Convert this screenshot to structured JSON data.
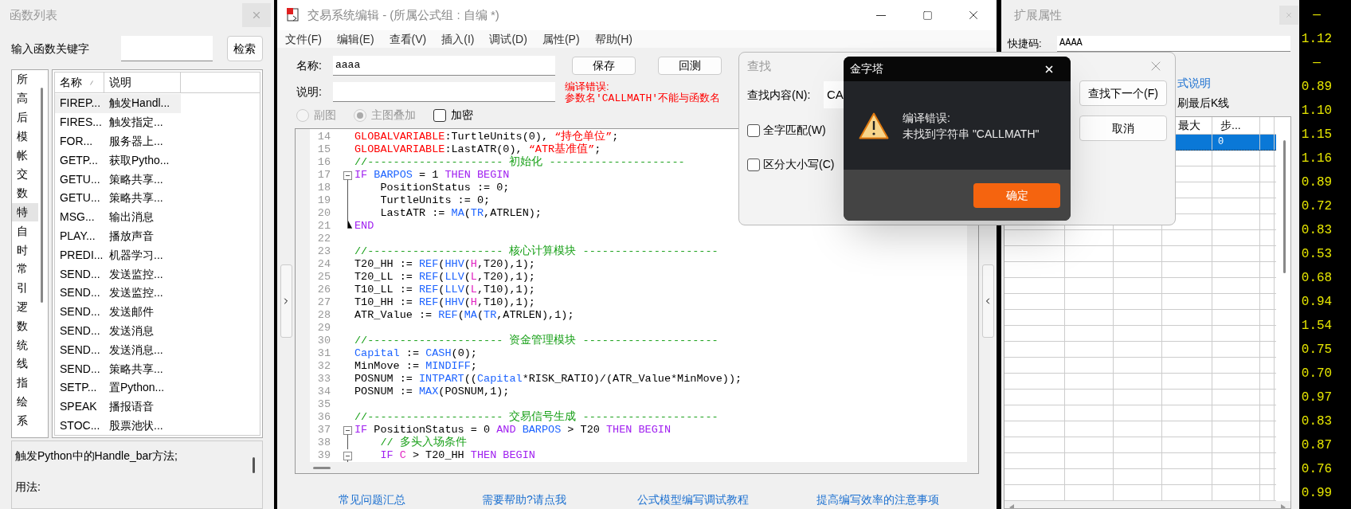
{
  "function_list": {
    "title": "函数列表",
    "search_label": "输入函数关键字",
    "search_button": "检索",
    "categories": [
      {
        "label": "所",
        "selected": false
      },
      {
        "label": "高",
        "selected": false
      },
      {
        "label": "后",
        "selected": false
      },
      {
        "label": "模",
        "selected": false
      },
      {
        "label": "帐",
        "selected": false
      },
      {
        "label": "交",
        "selected": false
      },
      {
        "label": "数",
        "selected": false
      },
      {
        "label": "特",
        "selected": true
      },
      {
        "label": "自",
        "selected": false
      },
      {
        "label": "时",
        "selected": false
      },
      {
        "label": "常",
        "selected": false
      },
      {
        "label": "引",
        "selected": false
      },
      {
        "label": "逻",
        "selected": false
      },
      {
        "label": "数",
        "selected": false
      },
      {
        "label": "统",
        "selected": false
      },
      {
        "label": "线",
        "selected": false
      },
      {
        "label": "指",
        "selected": false
      },
      {
        "label": "绘",
        "selected": false
      },
      {
        "label": "系",
        "selected": false
      }
    ],
    "columns": [
      "名称",
      "说明"
    ],
    "rows": [
      {
        "name": "FIREP...",
        "desc": "触发Handl...",
        "selected": true
      },
      {
        "name": "FIRES...",
        "desc": "触发指定...",
        "selected": false
      },
      {
        "name": "FOR...",
        "desc": "服务器上...",
        "selected": false
      },
      {
        "name": "GETP...",
        "desc": "获取Pytho...",
        "selected": false
      },
      {
        "name": "GETU...",
        "desc": "策略共享...",
        "selected": false
      },
      {
        "name": "GETU...",
        "desc": "策略共享...",
        "selected": false
      },
      {
        "name": "MSG...",
        "desc": "输出消息",
        "selected": false
      },
      {
        "name": "PLAY...",
        "desc": "播放声音",
        "selected": false
      },
      {
        "name": "PREDI...",
        "desc": "机器学习...",
        "selected": false
      },
      {
        "name": "SEND...",
        "desc": "发送监控...",
        "selected": false
      },
      {
        "name": "SEND...",
        "desc": "发送监控...",
        "selected": false
      },
      {
        "name": "SEND...",
        "desc": "发送邮件",
        "selected": false
      },
      {
        "name": "SEND...",
        "desc": "发送消息",
        "selected": false
      },
      {
        "name": "SEND...",
        "desc": "发送消息...",
        "selected": false
      },
      {
        "name": "SEND...",
        "desc": "策略共享...",
        "selected": false
      },
      {
        "name": "SETP...",
        "desc": "置Python...",
        "selected": false
      },
      {
        "name": "SPEAK",
        "desc": "播报语音",
        "selected": false
      },
      {
        "name": "STOC...",
        "desc": "股票池状...",
        "selected": false
      }
    ],
    "description": [
      "触发Python中的Handle_bar方法;",
      "用法:"
    ]
  },
  "editor": {
    "title": "交易系统编辑 - (所属公式组 : 自编 *)",
    "menu": [
      "文件(F)",
      "编辑(E)",
      "查看(V)",
      "插入(I)",
      "调试(D)",
      "属性(P)",
      "帮助(H)"
    ],
    "name_label": "名称:",
    "name_value": "aaaa",
    "desc_label": "说明:",
    "save_button": "保存",
    "backtest_button": "回测",
    "error_lines": [
      "编译错误:",
      "参数名'CALLMATH'不能与函数名"
    ],
    "options": [
      {
        "kind": "radio",
        "label": "副图",
        "selected": false,
        "disabled": true
      },
      {
        "kind": "radio",
        "label": "主图叠加",
        "selected": true,
        "disabled": true
      },
      {
        "kind": "checkbox",
        "label": "加密",
        "checked": false,
        "disabled": false
      }
    ],
    "code_lines": [
      {
        "number": "14",
        "tokens": [
          {
            "kind": "decl",
            "text": "GLOBALVARIABLE"
          },
          {
            "kind": "plain",
            "text": ":TurtleUnits(0), "
          },
          {
            "kind": "str",
            "text": "“持仓单位”"
          },
          {
            "kind": "plain",
            "text": ";"
          }
        ]
      },
      {
        "number": "15",
        "tokens": [
          {
            "kind": "decl",
            "text": "GLOBALVARIABLE"
          },
          {
            "kind": "plain",
            "text": ":LastATR(0), "
          },
          {
            "kind": "str",
            "text": "“ATR基准值”"
          },
          {
            "kind": "plain",
            "text": ";"
          }
        ]
      },
      {
        "number": "16",
        "tokens": [
          {
            "kind": "cmt",
            "text": "//--------------------- 初始化 ---------------------"
          }
        ]
      },
      {
        "number": "17",
        "fold": {
          "kind": "open"
        },
        "tokens": [
          {
            "kind": "kw",
            "text": "IF"
          },
          {
            "kind": "fn",
            "text": " BARPOS"
          },
          {
            "kind": "plain",
            "text": " = 1 "
          },
          {
            "kind": "kw",
            "text": "THEN"
          },
          {
            "kind": "kw",
            "text": " BEGIN"
          }
        ]
      },
      {
        "number": "18",
        "fold": {
          "kind": "line"
        },
        "tokens": [
          {
            "kind": "plain",
            "text": "    PositionStatus := 0;"
          }
        ]
      },
      {
        "number": "19",
        "fold": {
          "kind": "line"
        },
        "tokens": [
          {
            "kind": "plain",
            "text": "    TurtleUnits := 0;"
          }
        ]
      },
      {
        "number": "20",
        "fold": {
          "kind": "line"
        },
        "tokens": [
          {
            "kind": "plain",
            "text": "    LastATR := "
          },
          {
            "kind": "fn",
            "text": "MA"
          },
          {
            "kind": "plain",
            "text": "("
          },
          {
            "kind": "fn",
            "text": "TR"
          },
          {
            "kind": "plain",
            "text": ",ATRLEN);"
          }
        ]
      },
      {
        "number": "21",
        "fold": {
          "kind": "end"
        },
        "tokens": [
          {
            "kind": "kw",
            "text": "END"
          }
        ]
      },
      {
        "number": "22"
      },
      {
        "number": "23",
        "tokens": [
          {
            "kind": "cmt",
            "text": "//--------------------- 核心计算模块 ---------------------"
          }
        ]
      },
      {
        "number": "24",
        "tokens": [
          {
            "kind": "plain",
            "text": "T20_HH := "
          },
          {
            "kind": "fn",
            "text": "REF"
          },
          {
            "kind": "plain",
            "text": "("
          },
          {
            "kind": "fn",
            "text": "HHV"
          },
          {
            "kind": "plain",
            "text": "("
          },
          {
            "kind": "price",
            "text": "H"
          },
          {
            "kind": "plain",
            "text": ",T20),1);"
          }
        ]
      },
      {
        "number": "25",
        "tokens": [
          {
            "kind": "plain",
            "text": "T20_LL := "
          },
          {
            "kind": "fn",
            "text": "REF"
          },
          {
            "kind": "plain",
            "text": "("
          },
          {
            "kind": "fn",
            "text": "LLV"
          },
          {
            "kind": "plain",
            "text": "("
          },
          {
            "kind": "price",
            "text": "L"
          },
          {
            "kind": "plain",
            "text": ",T20),1);"
          }
        ]
      },
      {
        "number": "26",
        "tokens": [
          {
            "kind": "plain",
            "text": "T10_LL := "
          },
          {
            "kind": "fn",
            "text": "REF"
          },
          {
            "kind": "plain",
            "text": "("
          },
          {
            "kind": "fn",
            "text": "LLV"
          },
          {
            "kind": "plain",
            "text": "("
          },
          {
            "kind": "price",
            "text": "L"
          },
          {
            "kind": "plain",
            "text": ",T10),1);"
          }
        ]
      },
      {
        "number": "27",
        "tokens": [
          {
            "kind": "plain",
            "text": "T10_HH := "
          },
          {
            "kind": "fn",
            "text": "REF"
          },
          {
            "kind": "plain",
            "text": "("
          },
          {
            "kind": "fn",
            "text": "HHV"
          },
          {
            "kind": "plain",
            "text": "("
          },
          {
            "kind": "price",
            "text": "H"
          },
          {
            "kind": "plain",
            "text": ",T10),1);"
          }
        ]
      },
      {
        "number": "28",
        "tokens": [
          {
            "kind": "plain",
            "text": "ATR_Value := "
          },
          {
            "kind": "fn",
            "text": "REF"
          },
          {
            "kind": "plain",
            "text": "("
          },
          {
            "kind": "fn",
            "text": "MA"
          },
          {
            "kind": "plain",
            "text": "("
          },
          {
            "kind": "fn",
            "text": "TR"
          },
          {
            "kind": "plain",
            "text": ",ATRLEN),1);"
          }
        ]
      },
      {
        "number": "29"
      },
      {
        "number": "30",
        "tokens": [
          {
            "kind": "cmt",
            "text": "//--------------------- 资金管理模块 ---------------------"
          }
        ]
      },
      {
        "number": "31",
        "tokens": [
          {
            "kind": "fn",
            "text": "Capital"
          },
          {
            "kind": "plain",
            "text": " := "
          },
          {
            "kind": "fn",
            "text": "CASH"
          },
          {
            "kind": "plain",
            "text": "(0);"
          }
        ]
      },
      {
        "number": "32",
        "tokens": [
          {
            "kind": "plain",
            "text": "MinMove := "
          },
          {
            "kind": "fn",
            "text": "MINDIFF"
          },
          {
            "kind": "plain",
            "text": ";"
          }
        ]
      },
      {
        "number": "33",
        "tokens": [
          {
            "kind": "plain",
            "text": "POSNUM := "
          },
          {
            "kind": "fn",
            "text": "INTPART"
          },
          {
            "kind": "plain",
            "text": "(("
          },
          {
            "kind": "fn",
            "text": "Capital"
          },
          {
            "kind": "plain",
            "text": "*RISK_RATIO)/(ATR_Value*MinMove));"
          }
        ]
      },
      {
        "number": "34",
        "tokens": [
          {
            "kind": "plain",
            "text": "POSNUM := "
          },
          {
            "kind": "fn",
            "text": "MAX"
          },
          {
            "kind": "plain",
            "text": "(POSNUM,1);"
          }
        ]
      },
      {
        "number": "35"
      },
      {
        "number": "36",
        "tokens": [
          {
            "kind": "cmt",
            "text": "//--------------------- 交易信号生成 ---------------------"
          }
        ]
      },
      {
        "number": "37",
        "fold": {
          "kind": "open"
        },
        "tokens": [
          {
            "kind": "kw",
            "text": "IF"
          },
          {
            "kind": "plain",
            "text": " PositionStatus = 0 "
          },
          {
            "kind": "kw",
            "text": "AND"
          },
          {
            "kind": "fn",
            "text": " BARPOS"
          },
          {
            "kind": "plain",
            "text": " > T20 "
          },
          {
            "kind": "kw",
            "text": "THEN"
          },
          {
            "kind": "kw",
            "text": " BEGIN"
          }
        ]
      },
      {
        "number": "38",
        "fold": {
          "kind": "line"
        },
        "tokens": [
          {
            "kind": "cmt",
            "text": "    // 多头入场条件"
          }
        ]
      },
      {
        "number": "39",
        "fold": {
          "kind": "open"
        },
        "tokens": [
          {
            "kind": "kw",
            "text": "    IF"
          },
          {
            "kind": "price",
            "text": " C"
          },
          {
            "kind": "plain",
            "text": " > T20_HH "
          },
          {
            "kind": "kw",
            "text": "THEN"
          },
          {
            "kind": "kw",
            "text": " BEGIN"
          }
        ]
      }
    ],
    "links": [
      "常见问题汇总",
      "需要帮助?请点我",
      "公式模型编写调试教程",
      "提高编写效率的注意事项"
    ]
  },
  "find_dialog": {
    "title": "查找",
    "find_label": "查找内容(N):",
    "find_value": "CA",
    "options": [
      {
        "label": "全字匹配(W)",
        "checked": false
      },
      {
        "label": "区分大小写(C)",
        "checked": false
      }
    ],
    "buttons": [
      "查找下一个(F)",
      "取消"
    ]
  },
  "message_box": {
    "title": "金字塔",
    "lines": [
      "编译错误:",
      "未找到字符串 \"CALLMATH\""
    ],
    "ok_button": "确定"
  },
  "properties": {
    "title": "扩展属性",
    "shortcut_label": "快捷码:",
    "shortcut_value": "AAAA",
    "link": "式说明",
    "option_label": "刷最后K线",
    "columns": [
      "最大",
      "步..."
    ],
    "rows": [
      {
        "step": "0",
        "selected": true
      }
    ]
  },
  "price_strip": [
    "—",
    "1.12",
    "—",
    "0.89",
    "1.10",
    "1.15",
    "1.16",
    "0.89",
    "0.72",
    "0.83",
    "0.53",
    "0.68",
    "0.94",
    "1.54",
    "0.75",
    "0.70",
    "0.97",
    "0.83",
    "0.87",
    "0.76",
    "0.99"
  ]
}
